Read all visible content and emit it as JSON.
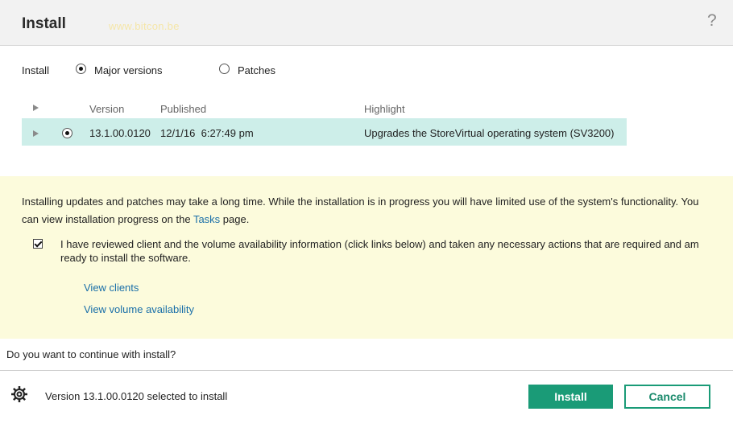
{
  "dialog": {
    "title": "Install",
    "watermark": "www.bitcon.be",
    "help_icon": "?"
  },
  "install_options": {
    "label": "Install",
    "options": [
      {
        "label": "Major versions",
        "selected": true
      },
      {
        "label": "Patches",
        "selected": false
      }
    ]
  },
  "table": {
    "columns": [
      "Version",
      "Published",
      "Highlight"
    ],
    "rows": [
      {
        "selected": true,
        "version": "13.1.00.0120",
        "published": "12/1/16  6:27:49 pm",
        "highlight": "Upgrades the StoreVirtual operating system (SV3200)"
      }
    ],
    "selected_row_color": "#cdeee9"
  },
  "notice": {
    "text_before": "Installing updates and patches may take a long time. While the installation is in progress you will have limited use of the system's functionality. You can view installation progress on the ",
    "tasks_link": "Tasks",
    "text_after": " page.",
    "acknowledge_checked": true,
    "acknowledge_text": "I have reviewed client and the volume availability information (click links below) and taken any necessary actions that are required and am ready to install the software.",
    "links": {
      "view_clients": "View clients",
      "view_volume": "View volume availability"
    },
    "background": "#fcfbdc"
  },
  "question": "Do you want to continue with install?",
  "footer": {
    "status_icon": "gear-icon",
    "status_text": "Version 13.1.00.0120 selected to install",
    "install_label": "Install",
    "cancel_label": "Cancel",
    "accent_color": "#1a9b77"
  }
}
